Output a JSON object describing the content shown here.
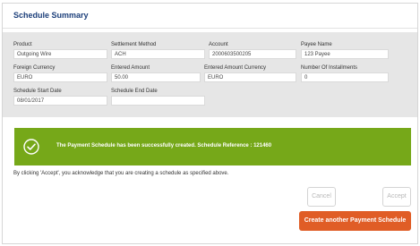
{
  "header": {
    "title": "Schedule Summary"
  },
  "summary": {
    "product": {
      "label": "Product",
      "value": "Outgoing Wire"
    },
    "settlement_method": {
      "label": "Settlement Method",
      "value": "ACH"
    },
    "account": {
      "label": "Account",
      "value": "2000603500205"
    },
    "payee_name": {
      "label": "Payee Name",
      "value": "123 Payee"
    },
    "foreign_currency": {
      "label": "Foreign Currency",
      "value": "EURO"
    },
    "entered_amount": {
      "label": "Entered Amount",
      "value": "50.00"
    },
    "entered_amount_currency": {
      "label": "Entered Amount Currency",
      "value": "EURO"
    },
    "number_of_installments": {
      "label": "Number Of Installments",
      "value": "0"
    },
    "schedule_start_date": {
      "label": "Schedule Start Date",
      "value": "08/01/2017"
    },
    "schedule_end_date": {
      "label": "Schedule End Date",
      "value": ""
    }
  },
  "banner": {
    "message": "The Payment Schedule has been successfully created. Schedule Reference : 121460",
    "color": "#76a819",
    "icon": "check-circle-icon"
  },
  "disclaimer": "By clicking 'Accept', you acknowledge that you are creating a schedule as specified above.",
  "actions": {
    "cancel_label": "Cancel",
    "accept_label": "Accept",
    "create_another_label": "Create another Payment Schedule",
    "create_another_color": "#e05d26"
  }
}
